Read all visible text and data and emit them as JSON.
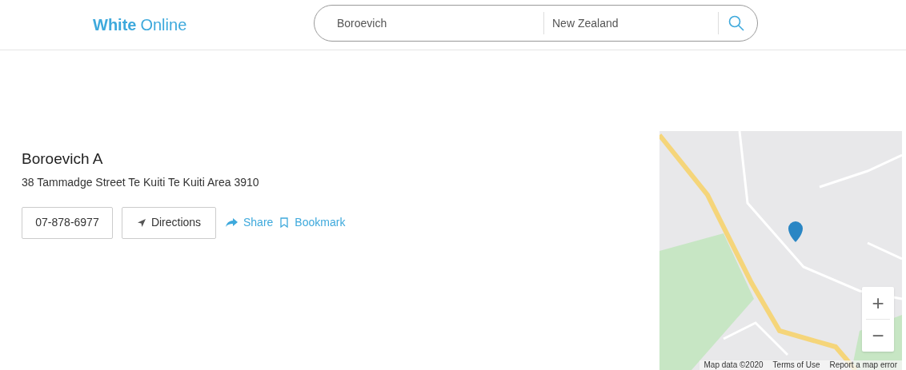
{
  "header": {
    "logo": {
      "bold": "White",
      "light": "Online"
    },
    "search": {
      "name_value": "Boroevich",
      "location_value": "New Zealand"
    }
  },
  "listing": {
    "name": "Boroevich A",
    "address": "38 Tammadge Street Te Kuiti Te Kuiti Area 3910",
    "phone": "07-878-6977",
    "directions": "Directions",
    "share": "Share",
    "bookmark": "Bookmark"
  },
  "map": {
    "zoom_in": "+",
    "zoom_out": "−",
    "attribution": [
      "Map data ©2020",
      "Terms of Use",
      "Report a map error"
    ]
  }
}
